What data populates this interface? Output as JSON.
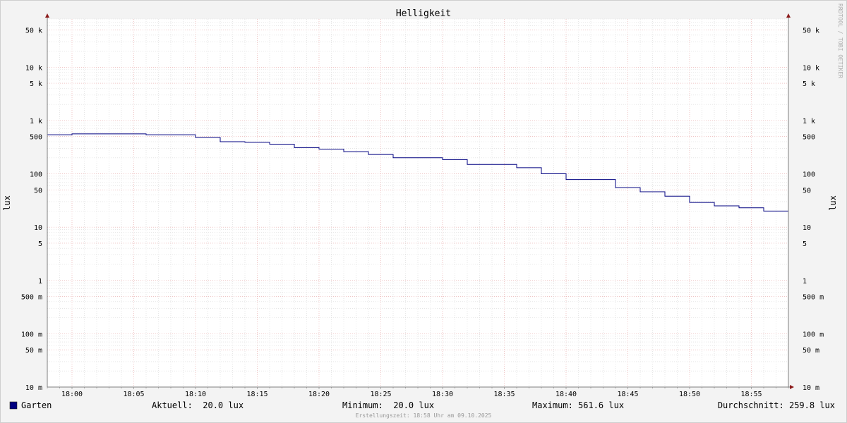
{
  "chart_data": {
    "type": "line",
    "title": "Helligkeit",
    "ylabel": "lux",
    "y_scale": "log",
    "ylim": [
      0.01,
      80000
    ],
    "xlim": [
      "17:58",
      "18:58"
    ],
    "grid": true,
    "y_ticks": [
      {
        "value": 50000,
        "label": "50 k"
      },
      {
        "value": 10000,
        "label": "10 k"
      },
      {
        "value": 5000,
        "label": "5 k"
      },
      {
        "value": 1000,
        "label": "1 k"
      },
      {
        "value": 500,
        "label": "500"
      },
      {
        "value": 100,
        "label": "100"
      },
      {
        "value": 50,
        "label": "50"
      },
      {
        "value": 10,
        "label": "10"
      },
      {
        "value": 5,
        "label": "5"
      },
      {
        "value": 1,
        "label": "1"
      },
      {
        "value": 0.5,
        "label": "500 m"
      },
      {
        "value": 0.1,
        "label": "100 m"
      },
      {
        "value": 0.05,
        "label": "50 m"
      },
      {
        "value": 0.01,
        "label": "10 m"
      }
    ],
    "x_ticks": [
      "18:00",
      "18:05",
      "18:10",
      "18:15",
      "18:20",
      "18:25",
      "18:30",
      "18:35",
      "18:40",
      "18:45",
      "18:50",
      "18:55"
    ],
    "series": [
      {
        "name": "Garten",
        "color": "#000080",
        "step": true,
        "x": [
          "17:58",
          "18:00",
          "18:06",
          "18:10",
          "18:12",
          "18:14",
          "18:16",
          "18:18",
          "18:20",
          "18:22",
          "18:24",
          "18:26",
          "18:30",
          "18:32",
          "18:36",
          "18:38",
          "18:40",
          "18:44",
          "18:46",
          "18:48",
          "18:50",
          "18:52",
          "18:54",
          "18:56",
          "18:58"
        ],
        "y": [
          540,
          561.6,
          540,
          480,
          400,
          390,
          360,
          310,
          290,
          260,
          230,
          200,
          185,
          150,
          130,
          100,
          78,
          55,
          46,
          38,
          29,
          25,
          23,
          20,
          20
        ]
      }
    ]
  },
  "legend": {
    "series_name": "Garten",
    "series_color": "#000080",
    "aktuell": "Aktuell:  20.0 lux",
    "minimum": "Minimum:  20.0 lux",
    "maximum": "Maximum: 561.6 lux",
    "durchschnitt": "Durchschnitt: 259.8 lux"
  },
  "footer": "Erstellungszeit: 18:58 Uhr am 09.10.2025",
  "watermark": "RRDTOOL / TOBI OETIKER"
}
